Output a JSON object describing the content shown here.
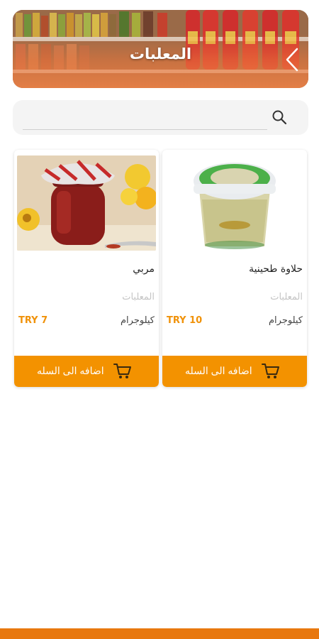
{
  "header": {
    "title": "المعلبات"
  },
  "search": {
    "placeholder": "",
    "value": ""
  },
  "products": [
    {
      "name": "حلاوة طحينية",
      "category": "المعلبات",
      "unit": "كيلوجرام",
      "price": "TRY 10",
      "add_label": "اضافه الى السله",
      "image_icon": "halva-tub-image"
    },
    {
      "name": "مربي",
      "category": "المعلبات",
      "unit": "كيلوجرام",
      "price": "TRY 7",
      "add_label": "اضافه الى السله",
      "image_icon": "jam-jar-image"
    }
  ],
  "colors": {
    "accent": "#f39200",
    "price": "#f0920a",
    "bottom_bar": "#e8780f",
    "category_text": "#c5c5c5"
  }
}
